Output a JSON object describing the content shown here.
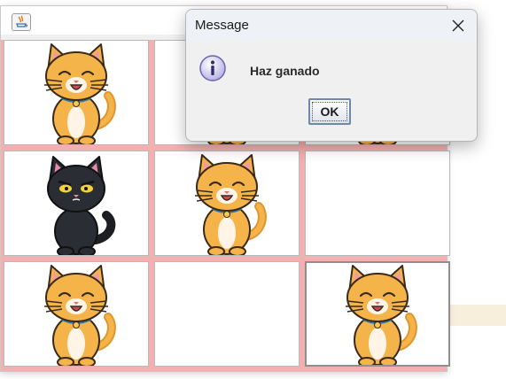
{
  "dialog": {
    "title": "Message",
    "message": "Haz ganado",
    "ok_label": "OK",
    "icon": "info-icon",
    "close_icon": "close-icon"
  },
  "board": {
    "cells": [
      {
        "content": "orange-cat-icon"
      },
      {
        "content": "orange-cat-icon"
      },
      {
        "content": "orange-cat-icon"
      },
      {
        "content": "black-cat-icon"
      },
      {
        "content": "orange-cat-icon"
      },
      {
        "content": "empty"
      },
      {
        "content": "orange-cat-icon"
      },
      {
        "content": "empty"
      },
      {
        "content": "orange-cat-icon"
      }
    ]
  },
  "colors": {
    "board_background": "#f2b0b0",
    "cat_orange": "#f5b44a",
    "cat_black": "#2a2d33",
    "dialog_background": "#f0f0f0"
  }
}
